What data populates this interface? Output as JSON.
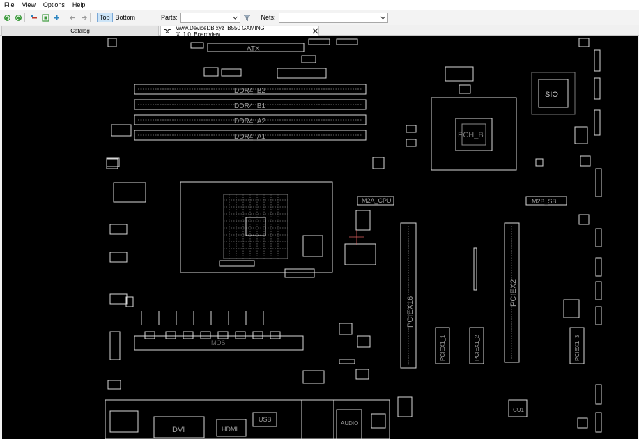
{
  "menu": {
    "items": [
      "File",
      "View",
      "Options",
      "Help"
    ]
  },
  "toolbar": {
    "top_label": "Top",
    "bottom_label": "Bottom",
    "parts_label": "Parts:",
    "parts_value": "",
    "nets_label": "Nets:",
    "nets_value": ""
  },
  "tabs": {
    "catalog": "Catalog",
    "board": "www.DeviceDB.xyz_B550 GAMING X_1.0_Boardview"
  },
  "board": {
    "labels": {
      "atx": "ATX",
      "ddr4_b2": "DDR4_B2",
      "ddr4_b1": "DDR4_B1",
      "ddr4_a2": "DDR4_A2",
      "ddr4_a1": "DDR4_A1",
      "sio": "SIO",
      "pch": "PCH_B",
      "m2a_cpu": "M2A_CPU",
      "m2b_sb": "M2B_SB",
      "pciex16": "PCIEX16",
      "pciex2": "PCIEX2",
      "pciex1_1": "PCIEX1_1",
      "pciex1_2": "PCIEX1_2",
      "pciex1_3": "PCIEX1_3",
      "dvi": "DVI",
      "hdmi": "HDMI",
      "audio": "AUDIO",
      "usb": "USB",
      "cu1": "CU1",
      "mos": "MOS"
    },
    "colors": {
      "background": "#000000",
      "outline": "#d8d8d8",
      "text": "#9a9a9a"
    }
  }
}
